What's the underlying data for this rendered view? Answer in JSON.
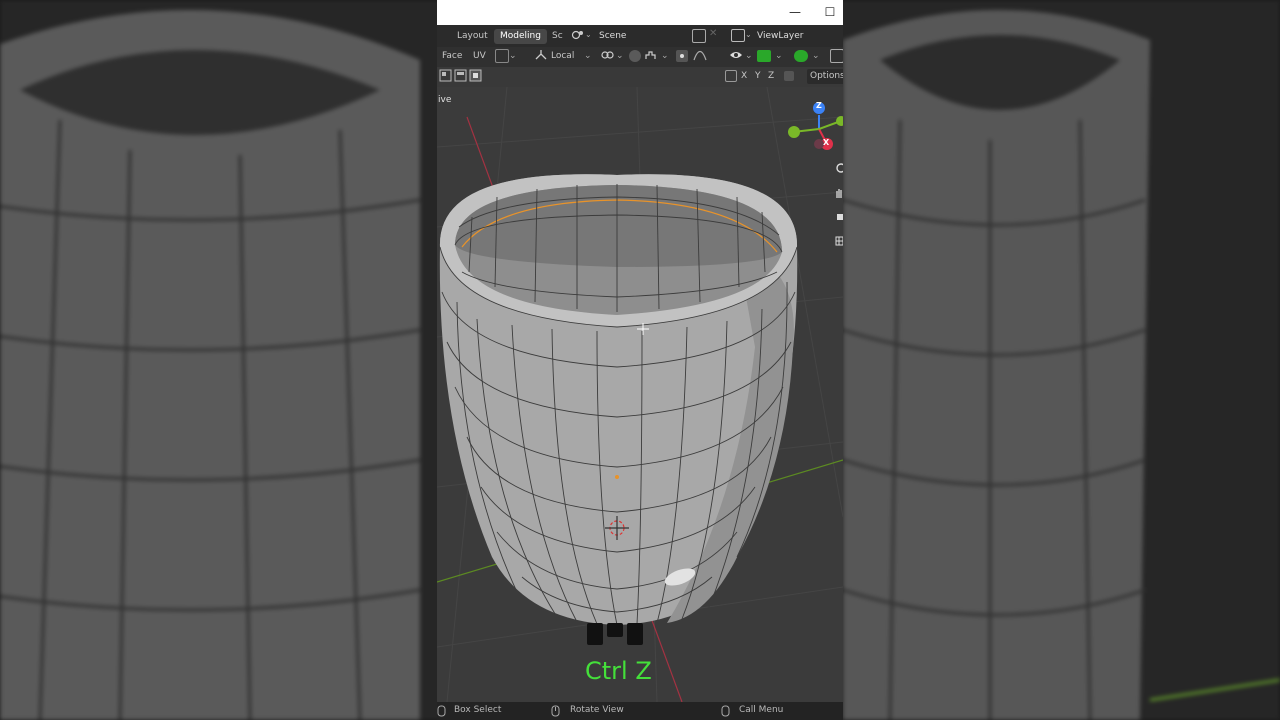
{
  "window": {
    "minimize_glyph": "—",
    "maximize_glyph": "☐"
  },
  "menubar": {
    "tabs": [
      "Layout",
      "Modeling",
      "Sc"
    ],
    "active_tab": "Modeling",
    "scene_name": "Scene",
    "view_layer": "ViewLayer"
  },
  "header": {
    "select_mode": "Face",
    "uv_label": "UV",
    "orientation": "Local",
    "axis_labels": [
      "X",
      "Y",
      "Z"
    ],
    "options_label": "Options"
  },
  "viewport": {
    "mode_label": "ive",
    "gizmo_axes": [
      "Z",
      "Y",
      "X"
    ],
    "key_overlay": "Ctrl Z"
  },
  "statusbar": {
    "items": [
      "Box Select",
      "Rotate View",
      "Call Menu"
    ]
  },
  "colors": {
    "key_overlay": "#44e03a",
    "active_tab": "#474747",
    "axis_z": "#3b82f6",
    "axis_y": "#7ab828",
    "axis_x": "#e0304a",
    "selection_edge": "#e8932a"
  }
}
